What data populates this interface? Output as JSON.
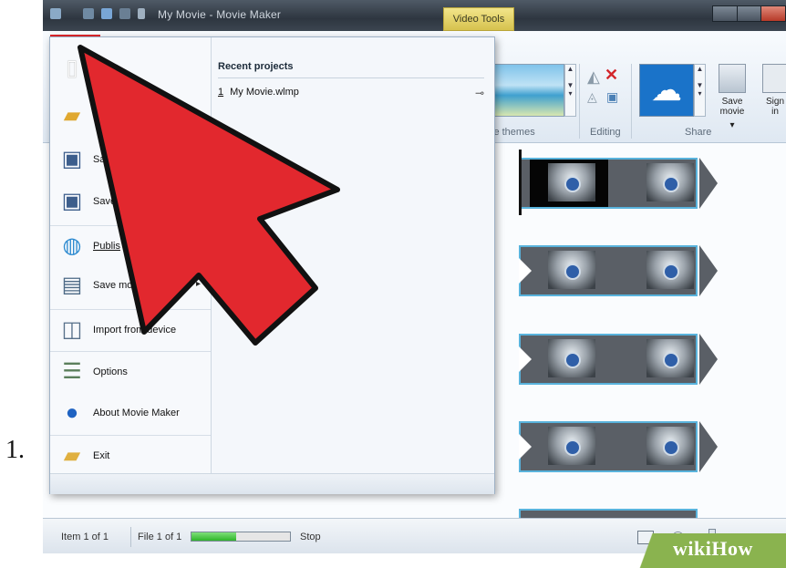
{
  "step_label": "1.",
  "window": {
    "title": "My Movie - Movie Maker",
    "context_tab": "Video Tools"
  },
  "ribbon": {
    "groups": [
      "ie themes",
      "Editing",
      "Share"
    ],
    "save_movie_label": "Save movie",
    "save_movie_caret": "▾",
    "sign_in_label": "Sign in"
  },
  "file_menu": {
    "items": [
      {
        "label": "",
        "icon": "new-project-icon"
      },
      {
        "label": "O",
        "icon": "open-folder-icon"
      },
      {
        "label": "Sa",
        "icon": "save-icon"
      },
      {
        "label": "Save",
        "icon": "save-as-icon"
      },
      {
        "label": "Publis",
        "icon": "publish-globe-icon"
      },
      {
        "label": "Save mo",
        "icon": "save-movie-icon"
      },
      {
        "label": "Import from device",
        "icon": "import-device-icon"
      },
      {
        "label": "Options",
        "icon": "options-icon"
      },
      {
        "label": "About Movie Maker",
        "icon": "info-icon"
      },
      {
        "label": "Exit",
        "icon": "exit-icon"
      }
    ],
    "recent_header": "Recent projects",
    "recent": [
      {
        "num": "1",
        "name": "My Movie.wlmp"
      }
    ]
  },
  "status": {
    "item": "Item 1 of 1",
    "file": "File 1 of 1",
    "progress": 0.45,
    "stop": "Stop"
  },
  "watermark": "wikiHow"
}
